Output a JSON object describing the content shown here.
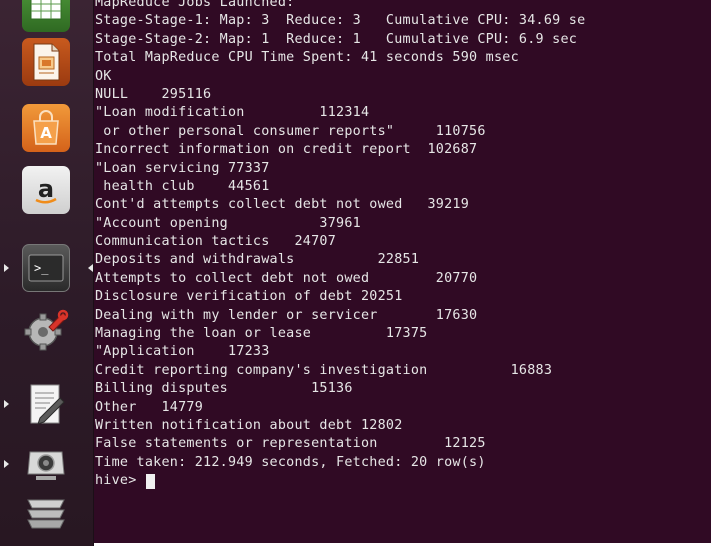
{
  "launcher": {
    "items": [
      {
        "name": "spreadsheet",
        "icon": "spreadsheet-icon"
      },
      {
        "name": "presentation",
        "icon": "presentation-icon"
      },
      {
        "name": "software-center",
        "icon": "shopping-bag-icon"
      },
      {
        "name": "amazon",
        "icon": "amazon-icon"
      },
      {
        "name": "terminal",
        "icon": "terminal-icon"
      },
      {
        "name": "system-settings",
        "icon": "gear-wrench-icon"
      },
      {
        "name": "text-editor",
        "icon": "text-editor-icon"
      },
      {
        "name": "cheese-webcam",
        "icon": "webcam-icon"
      },
      {
        "name": "workspaces",
        "icon": "workspace-icon"
      }
    ],
    "colors": {
      "launcher_bg": "#2d1b28",
      "terminal_bg": "#300a24",
      "terminal_fg": "#e6e6e6"
    }
  },
  "terminal": {
    "lines": [
      "MapReduce Jobs Launched:",
      "Stage-Stage-1: Map: 3  Reduce: 3   Cumulative CPU: 34.69 se",
      "Stage-Stage-2: Map: 1  Reduce: 1   Cumulative CPU: 6.9 sec",
      "Total MapReduce CPU Time Spent: 41 seconds 590 msec",
      "OK",
      "NULL    295116",
      "\"Loan modification         112314",
      " or other personal consumer reports\"     110756",
      "Incorrect information on credit report  102687",
      "\"Loan servicing 77337",
      " health club    44561",
      "Cont'd attempts collect debt not owed   39219",
      "\"Account opening           37961",
      "Communication tactics   24707",
      "Deposits and withdrawals          22851",
      "Attempts to collect debt not owed        20770",
      "Disclosure verification of debt 20251",
      "Dealing with my lender or servicer       17630",
      "Managing the loan or lease         17375",
      "\"Application    17233",
      "Credit reporting company's investigation          16883",
      "Billing disputes          15136",
      "Other   14779",
      "Written notification about debt 12802",
      "False statements or representation        12125",
      "Time taken: 212.949 seconds, Fetched: 20 row(s)"
    ],
    "prompt": "hive> "
  }
}
